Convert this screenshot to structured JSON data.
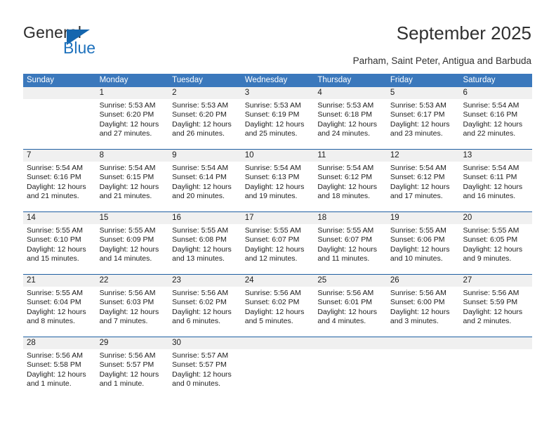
{
  "logo": {
    "word_one": "General",
    "word_two": "Blue",
    "icon": "triangle-mark",
    "color_primary": "#1f72bd",
    "color_text": "#2b2b2b"
  },
  "header": {
    "title": "September 2025",
    "subtitle": "Parham, Saint Peter, Antigua and Barbuda"
  },
  "theme": {
    "header_blue": "#3b78bc",
    "rule_blue": "#1f5fa2",
    "daynum_band": "#f0f0f0"
  },
  "calendar": {
    "weekdays": [
      "Sunday",
      "Monday",
      "Tuesday",
      "Wednesday",
      "Thursday",
      "Friday",
      "Saturday"
    ],
    "weeks": [
      [
        {
          "day": "",
          "lines": []
        },
        {
          "day": "1",
          "lines": [
            "Sunrise: 5:53 AM",
            "Sunset: 6:20 PM",
            "Daylight: 12 hours",
            "and 27 minutes."
          ]
        },
        {
          "day": "2",
          "lines": [
            "Sunrise: 5:53 AM",
            "Sunset: 6:20 PM",
            "Daylight: 12 hours",
            "and 26 minutes."
          ]
        },
        {
          "day": "3",
          "lines": [
            "Sunrise: 5:53 AM",
            "Sunset: 6:19 PM",
            "Daylight: 12 hours",
            "and 25 minutes."
          ]
        },
        {
          "day": "4",
          "lines": [
            "Sunrise: 5:53 AM",
            "Sunset: 6:18 PM",
            "Daylight: 12 hours",
            "and 24 minutes."
          ]
        },
        {
          "day": "5",
          "lines": [
            "Sunrise: 5:53 AM",
            "Sunset: 6:17 PM",
            "Daylight: 12 hours",
            "and 23 minutes."
          ]
        },
        {
          "day": "6",
          "lines": [
            "Sunrise: 5:54 AM",
            "Sunset: 6:16 PM",
            "Daylight: 12 hours",
            "and 22 minutes."
          ]
        }
      ],
      [
        {
          "day": "7",
          "lines": [
            "Sunrise: 5:54 AM",
            "Sunset: 6:16 PM",
            "Daylight: 12 hours",
            "and 21 minutes."
          ]
        },
        {
          "day": "8",
          "lines": [
            "Sunrise: 5:54 AM",
            "Sunset: 6:15 PM",
            "Daylight: 12 hours",
            "and 21 minutes."
          ]
        },
        {
          "day": "9",
          "lines": [
            "Sunrise: 5:54 AM",
            "Sunset: 6:14 PM",
            "Daylight: 12 hours",
            "and 20 minutes."
          ]
        },
        {
          "day": "10",
          "lines": [
            "Sunrise: 5:54 AM",
            "Sunset: 6:13 PM",
            "Daylight: 12 hours",
            "and 19 minutes."
          ]
        },
        {
          "day": "11",
          "lines": [
            "Sunrise: 5:54 AM",
            "Sunset: 6:12 PM",
            "Daylight: 12 hours",
            "and 18 minutes."
          ]
        },
        {
          "day": "12",
          "lines": [
            "Sunrise: 5:54 AM",
            "Sunset: 6:12 PM",
            "Daylight: 12 hours",
            "and 17 minutes."
          ]
        },
        {
          "day": "13",
          "lines": [
            "Sunrise: 5:54 AM",
            "Sunset: 6:11 PM",
            "Daylight: 12 hours",
            "and 16 minutes."
          ]
        }
      ],
      [
        {
          "day": "14",
          "lines": [
            "Sunrise: 5:55 AM",
            "Sunset: 6:10 PM",
            "Daylight: 12 hours",
            "and 15 minutes."
          ]
        },
        {
          "day": "15",
          "lines": [
            "Sunrise: 5:55 AM",
            "Sunset: 6:09 PM",
            "Daylight: 12 hours",
            "and 14 minutes."
          ]
        },
        {
          "day": "16",
          "lines": [
            "Sunrise: 5:55 AM",
            "Sunset: 6:08 PM",
            "Daylight: 12 hours",
            "and 13 minutes."
          ]
        },
        {
          "day": "17",
          "lines": [
            "Sunrise: 5:55 AM",
            "Sunset: 6:07 PM",
            "Daylight: 12 hours",
            "and 12 minutes."
          ]
        },
        {
          "day": "18",
          "lines": [
            "Sunrise: 5:55 AM",
            "Sunset: 6:07 PM",
            "Daylight: 12 hours",
            "and 11 minutes."
          ]
        },
        {
          "day": "19",
          "lines": [
            "Sunrise: 5:55 AM",
            "Sunset: 6:06 PM",
            "Daylight: 12 hours",
            "and 10 minutes."
          ]
        },
        {
          "day": "20",
          "lines": [
            "Sunrise: 5:55 AM",
            "Sunset: 6:05 PM",
            "Daylight: 12 hours",
            "and 9 minutes."
          ]
        }
      ],
      [
        {
          "day": "21",
          "lines": [
            "Sunrise: 5:55 AM",
            "Sunset: 6:04 PM",
            "Daylight: 12 hours",
            "and 8 minutes."
          ]
        },
        {
          "day": "22",
          "lines": [
            "Sunrise: 5:56 AM",
            "Sunset: 6:03 PM",
            "Daylight: 12 hours",
            "and 7 minutes."
          ]
        },
        {
          "day": "23",
          "lines": [
            "Sunrise: 5:56 AM",
            "Sunset: 6:02 PM",
            "Daylight: 12 hours",
            "and 6 minutes."
          ]
        },
        {
          "day": "24",
          "lines": [
            "Sunrise: 5:56 AM",
            "Sunset: 6:02 PM",
            "Daylight: 12 hours",
            "and 5 minutes."
          ]
        },
        {
          "day": "25",
          "lines": [
            "Sunrise: 5:56 AM",
            "Sunset: 6:01 PM",
            "Daylight: 12 hours",
            "and 4 minutes."
          ]
        },
        {
          "day": "26",
          "lines": [
            "Sunrise: 5:56 AM",
            "Sunset: 6:00 PM",
            "Daylight: 12 hours",
            "and 3 minutes."
          ]
        },
        {
          "day": "27",
          "lines": [
            "Sunrise: 5:56 AM",
            "Sunset: 5:59 PM",
            "Daylight: 12 hours",
            "and 2 minutes."
          ]
        }
      ],
      [
        {
          "day": "28",
          "lines": [
            "Sunrise: 5:56 AM",
            "Sunset: 5:58 PM",
            "Daylight: 12 hours",
            "and 1 minute."
          ]
        },
        {
          "day": "29",
          "lines": [
            "Sunrise: 5:56 AM",
            "Sunset: 5:57 PM",
            "Daylight: 12 hours",
            "and 1 minute."
          ]
        },
        {
          "day": "30",
          "lines": [
            "Sunrise: 5:57 AM",
            "Sunset: 5:57 PM",
            "Daylight: 12 hours",
            "and 0 minutes."
          ]
        },
        {
          "day": "",
          "lines": []
        },
        {
          "day": "",
          "lines": []
        },
        {
          "day": "",
          "lines": []
        },
        {
          "day": "",
          "lines": []
        }
      ]
    ]
  }
}
